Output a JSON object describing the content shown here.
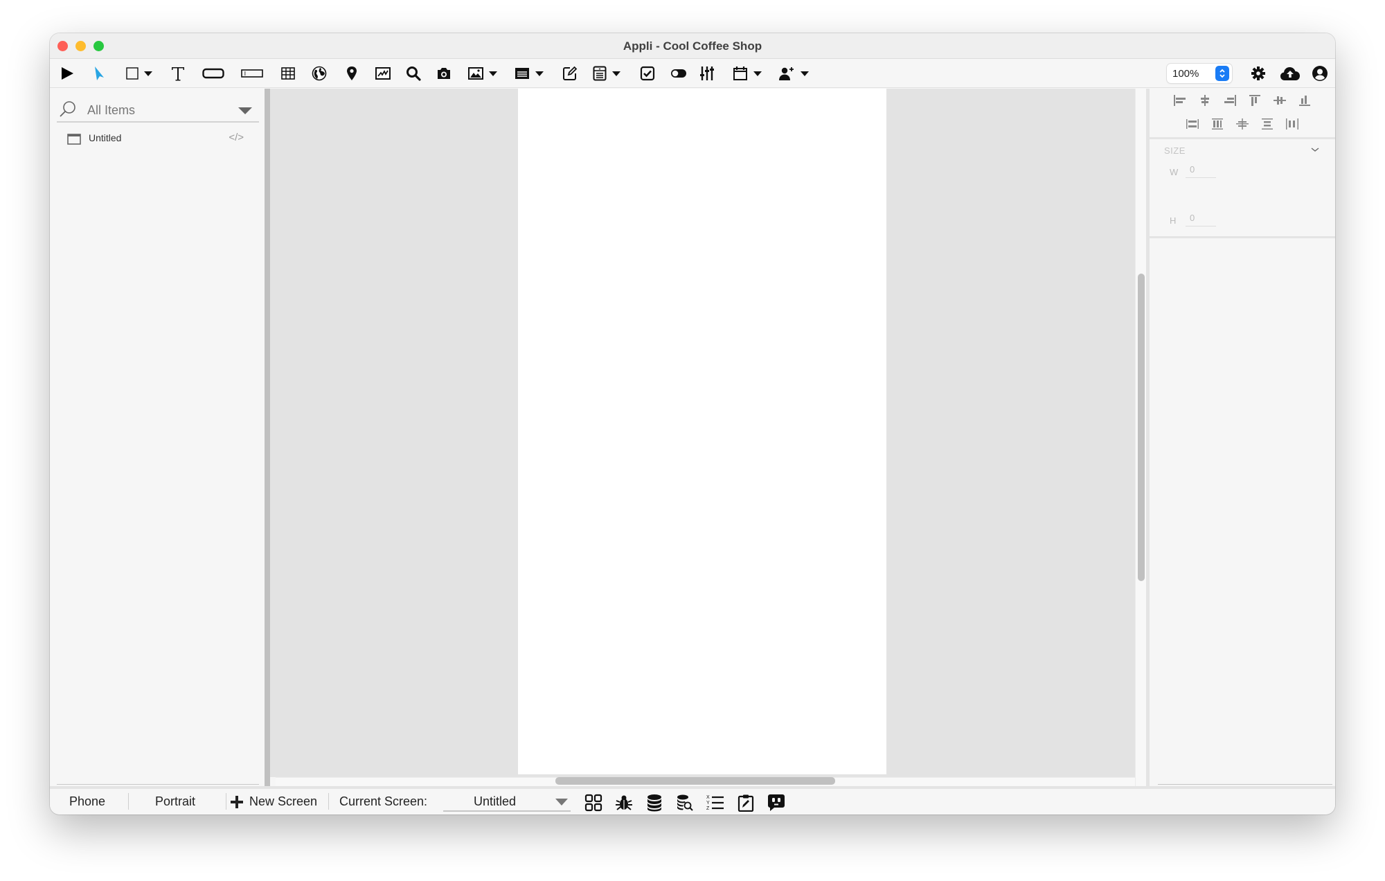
{
  "window": {
    "title": "Appli - Cool Coffee Shop"
  },
  "toolbar": {
    "tools": [
      {
        "name": "play-icon",
        "has_dropdown": false
      },
      {
        "name": "pointer-icon",
        "has_dropdown": false,
        "active": true
      },
      {
        "name": "rectangle-icon",
        "has_dropdown": true
      },
      {
        "name": "text-icon",
        "has_dropdown": false
      },
      {
        "name": "button-shape-icon",
        "has_dropdown": false
      },
      {
        "name": "text-field-icon",
        "has_dropdown": false
      },
      {
        "name": "table-icon",
        "has_dropdown": false
      },
      {
        "name": "globe-icon",
        "has_dropdown": false
      },
      {
        "name": "map-pin-icon",
        "has_dropdown": false
      },
      {
        "name": "chart-icon",
        "has_dropdown": false
      },
      {
        "name": "search-icon",
        "has_dropdown": false
      },
      {
        "name": "camera-icon",
        "has_dropdown": false
      },
      {
        "name": "image-icon",
        "has_dropdown": true
      },
      {
        "name": "list-icon",
        "has_dropdown": true
      },
      {
        "name": "edit-icon",
        "has_dropdown": false
      },
      {
        "name": "form-icon",
        "has_dropdown": true
      },
      {
        "name": "checkbox-icon",
        "has_dropdown": false
      },
      {
        "name": "toggle-icon",
        "has_dropdown": false
      },
      {
        "name": "sliders-icon",
        "has_dropdown": false
      },
      {
        "name": "calendar-icon",
        "has_dropdown": true
      },
      {
        "name": "add-user-icon",
        "has_dropdown": true
      }
    ],
    "zoom_value": "100%",
    "accent_color": "#1a7cf5",
    "pointer_color": "#29a5e3"
  },
  "left_panel": {
    "filter_label": "All Items",
    "items": [
      {
        "label": "Untitled",
        "code_glyph": "</>"
      }
    ]
  },
  "inspector": {
    "section_title": "SIZE",
    "width_label": "W",
    "width_value": "0",
    "height_label": "H",
    "height_value": "0"
  },
  "statusbar": {
    "device": "Phone",
    "orientation": "Portrait",
    "new_screen_label": "New Screen",
    "current_screen_label": "Current Screen:",
    "current_screen_value": "Untitled"
  }
}
